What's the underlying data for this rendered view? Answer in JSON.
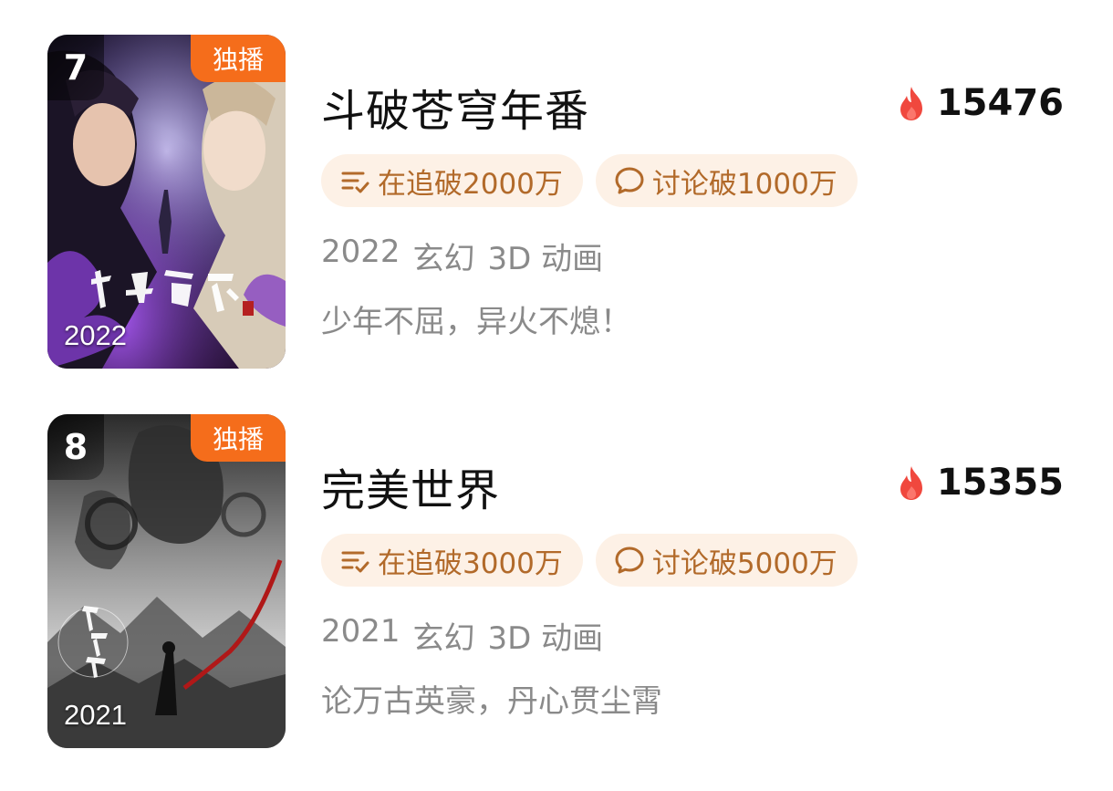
{
  "items": [
    {
      "rank": "7",
      "badge": "独播",
      "poster_year": "2022",
      "poster_title_art": "斗破苍穹",
      "title": "斗破苍穹年番",
      "heat": "15476",
      "tags": [
        {
          "icon": "follow-list-icon",
          "label": "在追破2000万"
        },
        {
          "icon": "comment-bubble-icon",
          "label": "讨论破1000万"
        }
      ],
      "meta": {
        "year": "2022",
        "genre": "玄幻",
        "format": "3D 动画"
      },
      "description": "少年不屈，异火不熄！"
    },
    {
      "rank": "8",
      "badge": "独播",
      "poster_year": "2021",
      "poster_title_art": "完美世界",
      "title": "完美世界",
      "heat": "15355",
      "tags": [
        {
          "icon": "follow-list-icon",
          "label": "在追破3000万"
        },
        {
          "icon": "comment-bubble-icon",
          "label": "讨论破5000万"
        }
      ],
      "meta": {
        "year": "2021",
        "genre": "玄幻",
        "format": "3D 动画"
      },
      "description": "论万古英豪，丹心贯尘霄"
    }
  ],
  "colors": {
    "badge_orange": "#f56d1b",
    "tag_bg": "#fdf1e6",
    "tag_text": "#b26a2a",
    "flame_red": "#f0483e"
  }
}
